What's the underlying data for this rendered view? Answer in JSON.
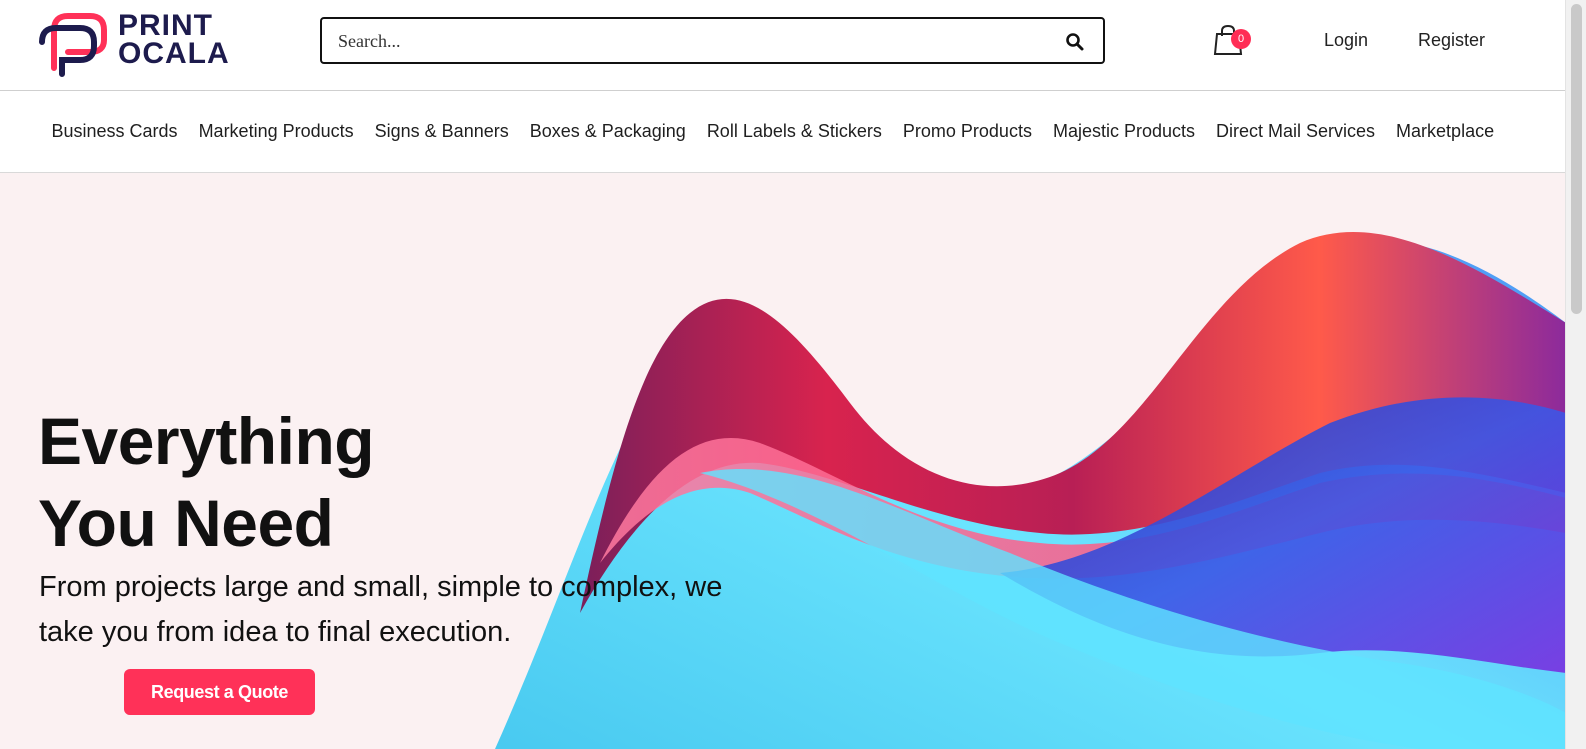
{
  "brand": {
    "line1": "PRINT",
    "line2": "OCALA"
  },
  "search": {
    "placeholder": "Search..."
  },
  "cart": {
    "count": "0"
  },
  "auth": {
    "login": "Login",
    "register": "Register"
  },
  "nav": {
    "items": [
      "Business Cards",
      "Marketing Products",
      "Signs & Banners",
      "Boxes & Packaging",
      "Roll Labels & Stickers",
      "Promo Products",
      "Majestic Products",
      "Direct Mail Services",
      "Marketplace"
    ]
  },
  "hero": {
    "title_line1": "Everything",
    "title_line2": "You Need",
    "subtitle": "From projects large and small, simple to complex, we take you from idea to final execution.",
    "cta": "Request a Quote"
  },
  "colors": {
    "accent": "#ff3158",
    "brand_navy": "#1d1b4d",
    "hero_bg": "#fbf1f2"
  }
}
